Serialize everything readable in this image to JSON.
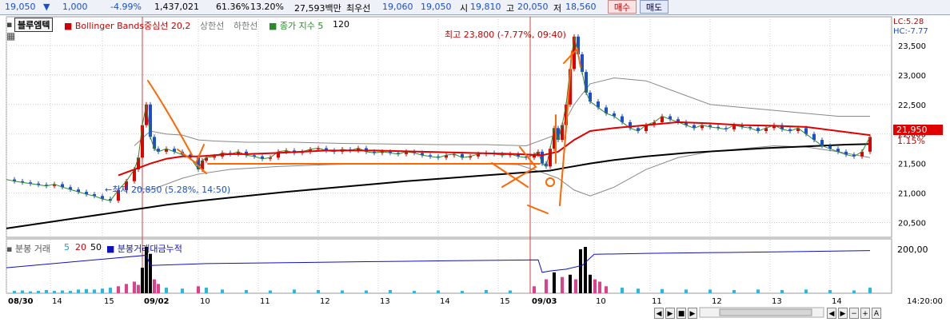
{
  "quote": {
    "price": "19,050",
    "arrow": "▼",
    "change": "1,000",
    "change_pct": "-4.99%",
    "volume": "1,437,021",
    "ratio1": "61.36%",
    "ratio2": "13.20%",
    "amount": "27,593백만",
    "best_label": "최우선",
    "best_ask": "19,060",
    "best_bid": "19,050",
    "open_label": "시",
    "open": "19,810",
    "high_label": "고",
    "high": "20,050",
    "low_label": "저",
    "low": "18,560",
    "buy_label": "매수",
    "sell_label": "매도"
  },
  "legend": {
    "title": "블루엠텍",
    "bb_label": "Bollinger Bands중심선 20,2",
    "upper_label": "상한선",
    "lower_label": "하한선",
    "close_index_label": "종가 지수 5",
    "close_index_extra": "120",
    "vol_label": "분봉 거래",
    "vol_5": "5",
    "vol_20": "20",
    "vol_50": "50",
    "vol_cum_label": "분봉거래대금누적",
    "lc": "LC:5.28",
    "hc": "HC:-7.77"
  },
  "annotations": {
    "max_label": "최고 23,800 (-7.77%, 09:40)",
    "min_label": "←최저 20,850 (5.28%, 14:50)",
    "last_price": "21,950",
    "last_pct": "1.15%",
    "vol_max": "200,00"
  },
  "colors": {
    "up": "#e00000",
    "down": "#1a4fd0",
    "middle": "#e00000",
    "band": "#888888",
    "ma": "#000000",
    "cum": "#1010c0",
    "annotation": "#ff6600",
    "ma5": "#2a8a2a"
  },
  "chart_data": {
    "type": "candlestick",
    "y_ticks": [
      "23,500",
      "23,000",
      "22,500",
      "22,000",
      "21,500",
      "21,000",
      "20,500"
    ],
    "y_tick_values": [
      23500,
      23000,
      22500,
      22000,
      21500,
      21000,
      20500
    ],
    "ylim": [
      20250,
      23850
    ],
    "x_ticks": [
      "08/30",
      "14",
      "15",
      "09/02",
      "10",
      "11",
      "12",
      "13",
      "14",
      "15",
      "09/03",
      "10",
      "11",
      "12",
      "13",
      "14",
      "14:20:00"
    ],
    "x_tick_positions": [
      0,
      55,
      120,
      170,
      240,
      315,
      390,
      465,
      540,
      615,
      655,
      735,
      805,
      880,
      955,
      1030,
      1090
    ],
    "day_separators": [
      170,
      655
    ],
    "max_point": {
      "price": 23800,
      "time": "09:40"
    },
    "min_point": {
      "price": 20850,
      "time": "14:50"
    },
    "close_series": [
      [
        0,
        21230
      ],
      [
        10,
        21200
      ],
      [
        20,
        21180
      ],
      [
        30,
        21160
      ],
      [
        40,
        21140
      ],
      [
        50,
        21120
      ],
      [
        60,
        21150
      ],
      [
        70,
        21100
      ],
      [
        80,
        21060
      ],
      [
        90,
        21020
      ],
      [
        100,
        20980
      ],
      [
        110,
        20950
      ],
      [
        120,
        20900
      ],
      [
        130,
        20870
      ],
      [
        140,
        21050
      ],
      [
        150,
        21200
      ],
      [
        160,
        21400
      ],
      [
        165,
        21600
      ],
      [
        170,
        22150
      ],
      [
        175,
        22500
      ],
      [
        180,
        21950
      ],
      [
        185,
        21750
      ],
      [
        190,
        21700
      ],
      [
        200,
        21750
      ],
      [
        210,
        21700
      ],
      [
        220,
        21650
      ],
      [
        230,
        21600
      ],
      [
        240,
        21400
      ],
      [
        245,
        21550
      ],
      [
        250,
        21600
      ],
      [
        260,
        21620
      ],
      [
        270,
        21680
      ],
      [
        280,
        21660
      ],
      [
        290,
        21700
      ],
      [
        300,
        21640
      ],
      [
        310,
        21620
      ],
      [
        320,
        21580
      ],
      [
        330,
        21600
      ],
      [
        340,
        21700
      ],
      [
        350,
        21720
      ],
      [
        360,
        21680
      ],
      [
        370,
        21700
      ],
      [
        380,
        21740
      ],
      [
        390,
        21760
      ],
      [
        400,
        21720
      ],
      [
        410,
        21700
      ],
      [
        420,
        21740
      ],
      [
        430,
        21720
      ],
      [
        440,
        21760
      ],
      [
        450,
        21700
      ],
      [
        460,
        21680
      ],
      [
        470,
        21700
      ],
      [
        480,
        21680
      ],
      [
        490,
        21660
      ],
      [
        500,
        21700
      ],
      [
        510,
        21680
      ],
      [
        520,
        21640
      ],
      [
        530,
        21620
      ],
      [
        540,
        21600
      ],
      [
        550,
        21640
      ],
      [
        560,
        21660
      ],
      [
        570,
        21600
      ],
      [
        580,
        21620
      ],
      [
        590,
        21660
      ],
      [
        600,
        21680
      ],
      [
        610,
        21660
      ],
      [
        620,
        21640
      ],
      [
        630,
        21660
      ],
      [
        640,
        21620
      ],
      [
        650,
        21600
      ],
      [
        660,
        21650
      ],
      [
        665,
        21700
      ],
      [
        670,
        21500
      ],
      [
        675,
        21450
      ],
      [
        680,
        21750
      ],
      [
        685,
        22100
      ],
      [
        690,
        21900
      ],
      [
        695,
        22150
      ],
      [
        700,
        22500
      ],
      [
        705,
        23100
      ],
      [
        710,
        23650
      ],
      [
        715,
        23350
      ],
      [
        720,
        23050
      ],
      [
        725,
        22700
      ],
      [
        730,
        22550
      ],
      [
        740,
        22450
      ],
      [
        750,
        22350
      ],
      [
        760,
        22300
      ],
      [
        770,
        22200
      ],
      [
        780,
        22100
      ],
      [
        790,
        22050
      ],
      [
        800,
        22150
      ],
      [
        810,
        22200
      ],
      [
        820,
        22300
      ],
      [
        830,
        22250
      ],
      [
        840,
        22200
      ],
      [
        850,
        22150
      ],
      [
        860,
        22100
      ],
      [
        870,
        22150
      ],
      [
        880,
        22120
      ],
      [
        890,
        22100
      ],
      [
        900,
        22080
      ],
      [
        910,
        22150
      ],
      [
        920,
        22120
      ],
      [
        930,
        22100
      ],
      [
        940,
        22050
      ],
      [
        950,
        22100
      ],
      [
        960,
        22150
      ],
      [
        970,
        22080
      ],
      [
        980,
        22050
      ],
      [
        990,
        22100
      ],
      [
        1000,
        22000
      ],
      [
        1010,
        21900
      ],
      [
        1020,
        21800
      ],
      [
        1030,
        21750
      ],
      [
        1040,
        21700
      ],
      [
        1050,
        21650
      ],
      [
        1060,
        21620
      ],
      [
        1070,
        21700
      ],
      [
        1080,
        21950
      ]
    ],
    "middle_series": [
      [
        140,
        21300
      ],
      [
        160,
        21400
      ],
      [
        180,
        21500
      ],
      [
        200,
        21580
      ],
      [
        220,
        21620
      ],
      [
        240,
        21620
      ],
      [
        260,
        21640
      ],
      [
        280,
        21660
      ],
      [
        300,
        21660
      ],
      [
        340,
        21680
      ],
      [
        400,
        21720
      ],
      [
        460,
        21720
      ],
      [
        520,
        21700
      ],
      [
        580,
        21680
      ],
      [
        640,
        21660
      ],
      [
        670,
        21640
      ],
      [
        690,
        21700
      ],
      [
        710,
        21900
      ],
      [
        730,
        22050
      ],
      [
        760,
        22100
      ],
      [
        800,
        22150
      ],
      [
        840,
        22200
      ],
      [
        880,
        22180
      ],
      [
        920,
        22150
      ],
      [
        960,
        22140
      ],
      [
        1000,
        22120
      ],
      [
        1040,
        22050
      ],
      [
        1080,
        21980
      ]
    ],
    "upper_series": [
      [
        160,
        21800
      ],
      [
        180,
        22050
      ],
      [
        200,
        22000
      ],
      [
        220,
        21980
      ],
      [
        240,
        21900
      ],
      [
        260,
        21880
      ],
      [
        300,
        21860
      ],
      [
        360,
        21860
      ],
      [
        420,
        21840
      ],
      [
        480,
        21830
      ],
      [
        540,
        21820
      ],
      [
        600,
        21820
      ],
      [
        650,
        21800
      ],
      [
        690,
        22000
      ],
      [
        710,
        22500
      ],
      [
        730,
        22850
      ],
      [
        760,
        22950
      ],
      [
        800,
        22900
      ],
      [
        840,
        22700
      ],
      [
        880,
        22500
      ],
      [
        920,
        22450
      ],
      [
        960,
        22400
      ],
      [
        1000,
        22350
      ],
      [
        1040,
        22300
      ],
      [
        1080,
        22300
      ]
    ],
    "lower_series": [
      [
        160,
        21100
      ],
      [
        180,
        21050
      ],
      [
        200,
        21150
      ],
      [
        220,
        21250
      ],
      [
        240,
        21320
      ],
      [
        280,
        21400
      ],
      [
        340,
        21450
      ],
      [
        400,
        21480
      ],
      [
        460,
        21500
      ],
      [
        520,
        21500
      ],
      [
        580,
        21500
      ],
      [
        640,
        21480
      ],
      [
        670,
        21350
      ],
      [
        690,
        21250
      ],
      [
        710,
        21050
      ],
      [
        730,
        20950
      ],
      [
        760,
        21100
      ],
      [
        800,
        21400
      ],
      [
        840,
        21600
      ],
      [
        880,
        21700
      ],
      [
        920,
        21750
      ],
      [
        960,
        21800
      ],
      [
        1000,
        21780
      ],
      [
        1040,
        21700
      ],
      [
        1080,
        21600
      ]
    ],
    "ma120_series": [
      [
        0,
        20400
      ],
      [
        50,
        20500
      ],
      [
        100,
        20600
      ],
      [
        150,
        20700
      ],
      [
        200,
        20800
      ],
      [
        250,
        20880
      ],
      [
        300,
        20950
      ],
      [
        350,
        21020
      ],
      [
        400,
        21080
      ],
      [
        450,
        21140
      ],
      [
        500,
        21200
      ],
      [
        550,
        21250
      ],
      [
        600,
        21300
      ],
      [
        650,
        21350
      ],
      [
        680,
        21380
      ],
      [
        700,
        21430
      ],
      [
        730,
        21500
      ],
      [
        760,
        21560
      ],
      [
        800,
        21620
      ],
      [
        850,
        21680
      ],
      [
        900,
        21720
      ],
      [
        950,
        21760
      ],
      [
        1000,
        21790
      ],
      [
        1050,
        21820
      ],
      [
        1080,
        21830
      ]
    ],
    "volume_cum_series": [
      [
        0,
        0.55
      ],
      [
        175,
        0.82
      ],
      [
        180,
        0.6
      ],
      [
        250,
        0.64
      ],
      [
        350,
        0.66
      ],
      [
        450,
        0.68
      ],
      [
        550,
        0.7
      ],
      [
        665,
        0.72
      ],
      [
        670,
        0.45
      ],
      [
        680,
        0.48
      ],
      [
        700,
        0.52
      ],
      [
        720,
        0.6
      ],
      [
        735,
        0.84
      ],
      [
        800,
        0.86
      ],
      [
        900,
        0.88
      ],
      [
        1000,
        0.9
      ],
      [
        1080,
        0.92
      ]
    ],
    "volume_bars": [
      [
        10,
        0.05
      ],
      [
        20,
        0.06
      ],
      [
        30,
        0.04
      ],
      [
        40,
        0.05
      ],
      [
        50,
        0.07
      ],
      [
        60,
        0.05
      ],
      [
        70,
        0.06
      ],
      [
        80,
        0.05
      ],
      [
        90,
        0.08
      ],
      [
        100,
        0.09
      ],
      [
        110,
        0.08
      ],
      [
        120,
        0.1
      ],
      [
        130,
        0.12
      ],
      [
        140,
        0.15
      ],
      [
        150,
        0.2
      ],
      [
        160,
        0.25
      ],
      [
        165,
        0.18
      ],
      [
        170,
        0.55
      ],
      [
        175,
        1.0
      ],
      [
        180,
        0.85
      ],
      [
        185,
        0.3
      ],
      [
        190,
        0.2
      ],
      [
        200,
        0.12
      ],
      [
        220,
        0.1
      ],
      [
        240,
        0.15
      ],
      [
        250,
        0.12
      ],
      [
        270,
        0.08
      ],
      [
        300,
        0.07
      ],
      [
        330,
        0.06
      ],
      [
        360,
        0.08
      ],
      [
        390,
        0.07
      ],
      [
        420,
        0.06
      ],
      [
        450,
        0.06
      ],
      [
        480,
        0.07
      ],
      [
        510,
        0.05
      ],
      [
        540,
        0.06
      ],
      [
        570,
        0.05
      ],
      [
        600,
        0.07
      ],
      [
        630,
        0.06
      ],
      [
        660,
        0.15
      ],
      [
        675,
        0.3
      ],
      [
        685,
        0.45
      ],
      [
        695,
        0.35
      ],
      [
        705,
        0.4
      ],
      [
        712,
        0.3
      ],
      [
        718,
        0.95
      ],
      [
        724,
        1.0
      ],
      [
        730,
        0.4
      ],
      [
        736,
        0.3
      ],
      [
        742,
        0.25
      ],
      [
        750,
        0.15
      ],
      [
        770,
        0.12
      ],
      [
        790,
        0.1
      ],
      [
        820,
        0.09
      ],
      [
        850,
        0.08
      ],
      [
        880,
        0.08
      ],
      [
        910,
        0.07
      ],
      [
        940,
        0.08
      ],
      [
        970,
        0.07
      ],
      [
        1000,
        0.08
      ],
      [
        1030,
        0.07
      ],
      [
        1060,
        0.06
      ],
      [
        1080,
        0.12
      ]
    ]
  }
}
